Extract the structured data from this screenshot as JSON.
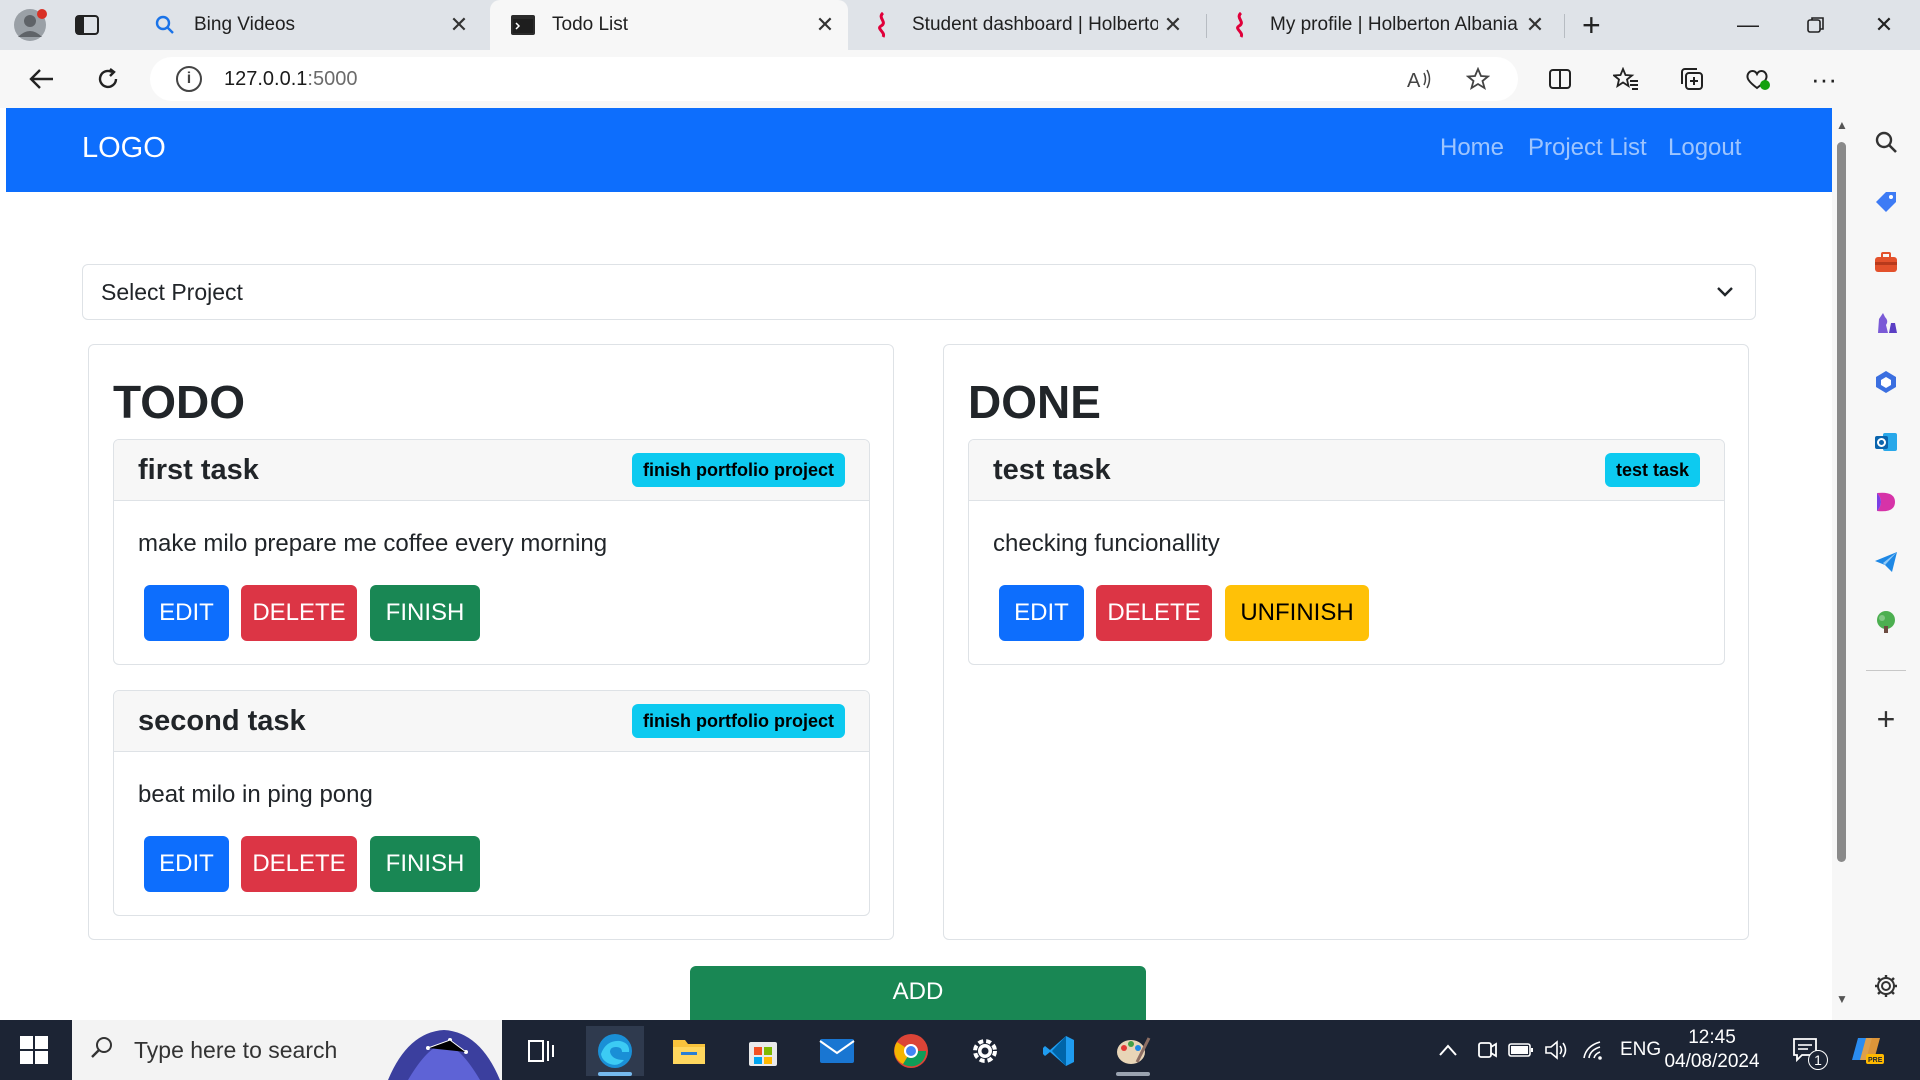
{
  "browser": {
    "tabs": [
      {
        "title": "Bing Videos",
        "active": false
      },
      {
        "title": "Todo List",
        "active": true
      },
      {
        "title": "Student dashboard | Holberton A",
        "active": false
      },
      {
        "title": "My profile | Holberton Albania In",
        "active": false
      }
    ],
    "url_host": "127.0.0.1",
    "url_port": ":5000"
  },
  "page": {
    "logo": "LOGO",
    "nav_links": [
      "Home",
      "Project List",
      "Logout"
    ],
    "select_label": "Select Project",
    "todo_heading": "TODO",
    "done_heading": "DONE",
    "todo_tasks": [
      {
        "title": "first task",
        "badge": "finish portfolio project",
        "description": "make milo prepare me coffee every morning",
        "edit": "EDIT",
        "delete": "DELETE",
        "action": "FINISH"
      },
      {
        "title": "second task",
        "badge": "finish portfolio project",
        "description": "beat milo in ping pong",
        "edit": "EDIT",
        "delete": "DELETE",
        "action": "FINISH"
      }
    ],
    "done_tasks": [
      {
        "title": "test task",
        "badge": "test task",
        "description": "checking funcionallity",
        "edit": "EDIT",
        "delete": "DELETE",
        "action": "UNFINISH"
      }
    ],
    "add_label": "ADD"
  },
  "taskbar": {
    "search_placeholder": "Type here to search",
    "language": "ENG",
    "time": "12:45",
    "date": "04/08/2024",
    "notification_count": "1"
  },
  "colors": {
    "primary": "#0d6efd",
    "danger": "#dc3545",
    "success": "#198754",
    "warning": "#ffc107",
    "info": "#0dcaf0"
  }
}
